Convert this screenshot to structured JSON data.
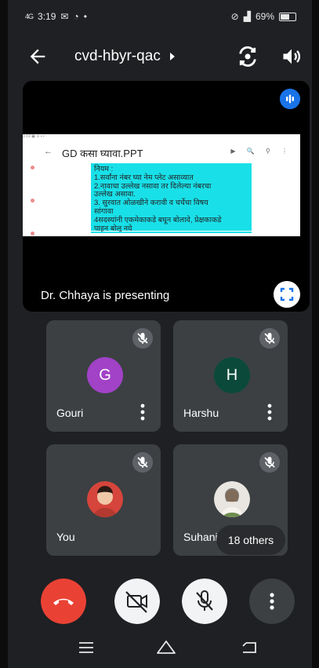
{
  "status_bar": {
    "time": "3:19",
    "signal_small": "4G",
    "battery_percent_text": "69%",
    "battery_level": 0.69
  },
  "header": {
    "meeting_code": "cvd-hbyr-qac"
  },
  "presentation": {
    "presenter_label": "Dr. Chhaya is presenting",
    "slide_status": "3:19 ▣ ⊙ ▪ •",
    "slide_title": "GD कसा घ्यावा.PPT",
    "slide_lines": [
      "नियम :",
      "1.सर्वांना नंबर घ्या नेम प्लेट असाव्यात",
      "2.नावाचा उल्लेख नसावा तर दिलेल्या नंबरचा",
      "उल्लेख असावा.",
      "3. सुरवात ओळखीने करावी व चर्चेचा विषय",
      "सांगावा",
      "4सदस्यांनी एकमेकाकडे बघून बोलावे, प्रेक्षकाकडे",
      "पाहून बोलू नये"
    ]
  },
  "participants": [
    {
      "name": "Gouri",
      "initial": "G",
      "avatar_color": "#a142c7",
      "muted": true
    },
    {
      "name": "Harshu",
      "initial": "H",
      "avatar_color": "#0b4a3a",
      "muted": true
    },
    {
      "name": "You",
      "initial": "",
      "avatar_color": "#d6453b",
      "muted": true
    },
    {
      "name": "Suhani",
      "initial": "",
      "avatar_color": "#e9e5e0",
      "muted": true
    }
  ],
  "others_label": "18 others",
  "colors": {
    "end_call": "#e94235",
    "tile_bg": "#3c4043",
    "screen_bg": "#1f2023",
    "accent": "#1a73e8",
    "slide_box": "#19e0e8"
  },
  "icons": [
    "back-arrow-icon",
    "chevron-right-icon",
    "camera-flip-icon",
    "speaker-icon",
    "audio-activity-icon",
    "fullscreen-icon",
    "mic-off-icon",
    "more-vert-icon",
    "end-call-icon",
    "video-off-icon"
  ]
}
